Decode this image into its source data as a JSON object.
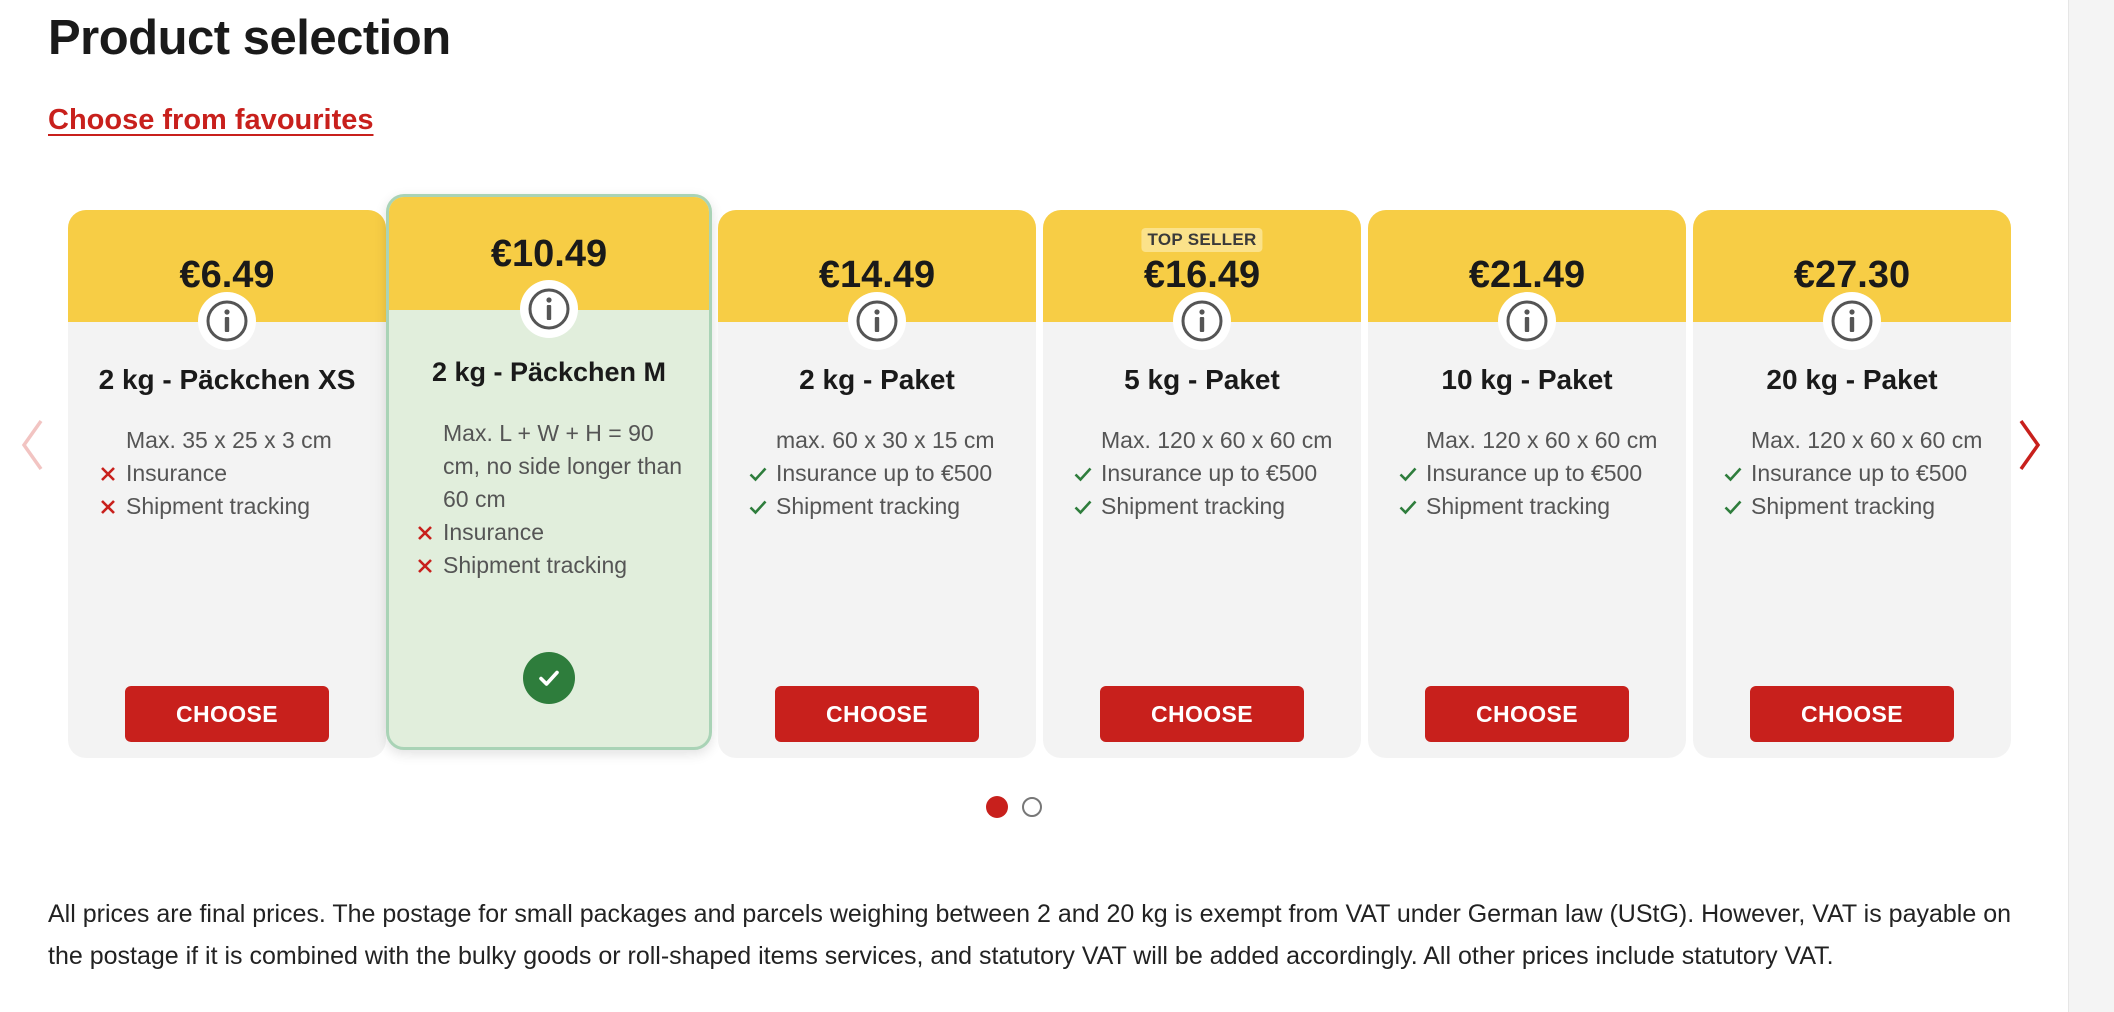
{
  "page": {
    "title": "Product selection",
    "favourites_link": "Choose from favourites"
  },
  "products": [
    {
      "price": "€6.49",
      "badge": "",
      "name": "2 kg - Päckchen XS",
      "dims": "Max. 35 x 25 x 3 cm",
      "features": [
        {
          "text": "Insurance",
          "included": false
        },
        {
          "text": "Shipment tracking",
          "included": false
        }
      ],
      "action": "CHOOSE",
      "selected": false
    },
    {
      "price": "€10.49",
      "badge": "",
      "name": "2 kg - Päckchen M",
      "dims": "Max. L + W + H = 90 cm, no side longer than 60 cm",
      "features": [
        {
          "text": "Insurance",
          "included": false
        },
        {
          "text": "Shipment tracking",
          "included": false
        }
      ],
      "action": "",
      "selected": true
    },
    {
      "price": "€14.49",
      "badge": "",
      "name": "2 kg - Paket",
      "dims": "max. 60 x 30 x 15 cm",
      "features": [
        {
          "text": "Insurance up to €500",
          "included": true
        },
        {
          "text": "Shipment tracking",
          "included": true
        }
      ],
      "action": "CHOOSE",
      "selected": false
    },
    {
      "price": "€16.49",
      "badge": "TOP SELLER",
      "name": "5 kg - Paket",
      "dims": "Max. 120 x 60 x 60 cm",
      "features": [
        {
          "text": "Insurance up to €500",
          "included": true
        },
        {
          "text": "Shipment tracking",
          "included": true
        }
      ],
      "action": "CHOOSE",
      "selected": false
    },
    {
      "price": "€21.49",
      "badge": "",
      "name": "10 kg - Paket",
      "dims": "Max. 120 x 60 x 60 cm",
      "features": [
        {
          "text": "Insurance up to €500",
          "included": true
        },
        {
          "text": "Shipment tracking",
          "included": true
        }
      ],
      "action": "CHOOSE",
      "selected": false
    },
    {
      "price": "€27.30",
      "badge": "",
      "name": "20 kg - Paket",
      "dims": "Max. 120 x 60 x 60 cm",
      "features": [
        {
          "text": "Insurance up to €500",
          "included": true
        },
        {
          "text": "Shipment tracking",
          "included": true
        }
      ],
      "action": "CHOOSE",
      "selected": false
    }
  ],
  "carousel": {
    "prev_icon": "chevron-left-icon",
    "next_icon": "chevron-right-icon",
    "pages": 2,
    "active_page": 1
  },
  "colors": {
    "accent_red": "#c8201c",
    "header_yellow": "#f7cd45",
    "selected_green": "#e1eedc",
    "check_green": "#2e7d3c"
  },
  "footnote": "All prices are final prices. The postage for small packages and parcels weighing between 2 and 20 kg is exempt from VAT under German law (UStG). However, VAT is payable on the postage if it is combined with the bulky goods or roll-shaped items services, and statutory VAT will be added accordingly. All other prices include statutory VAT."
}
